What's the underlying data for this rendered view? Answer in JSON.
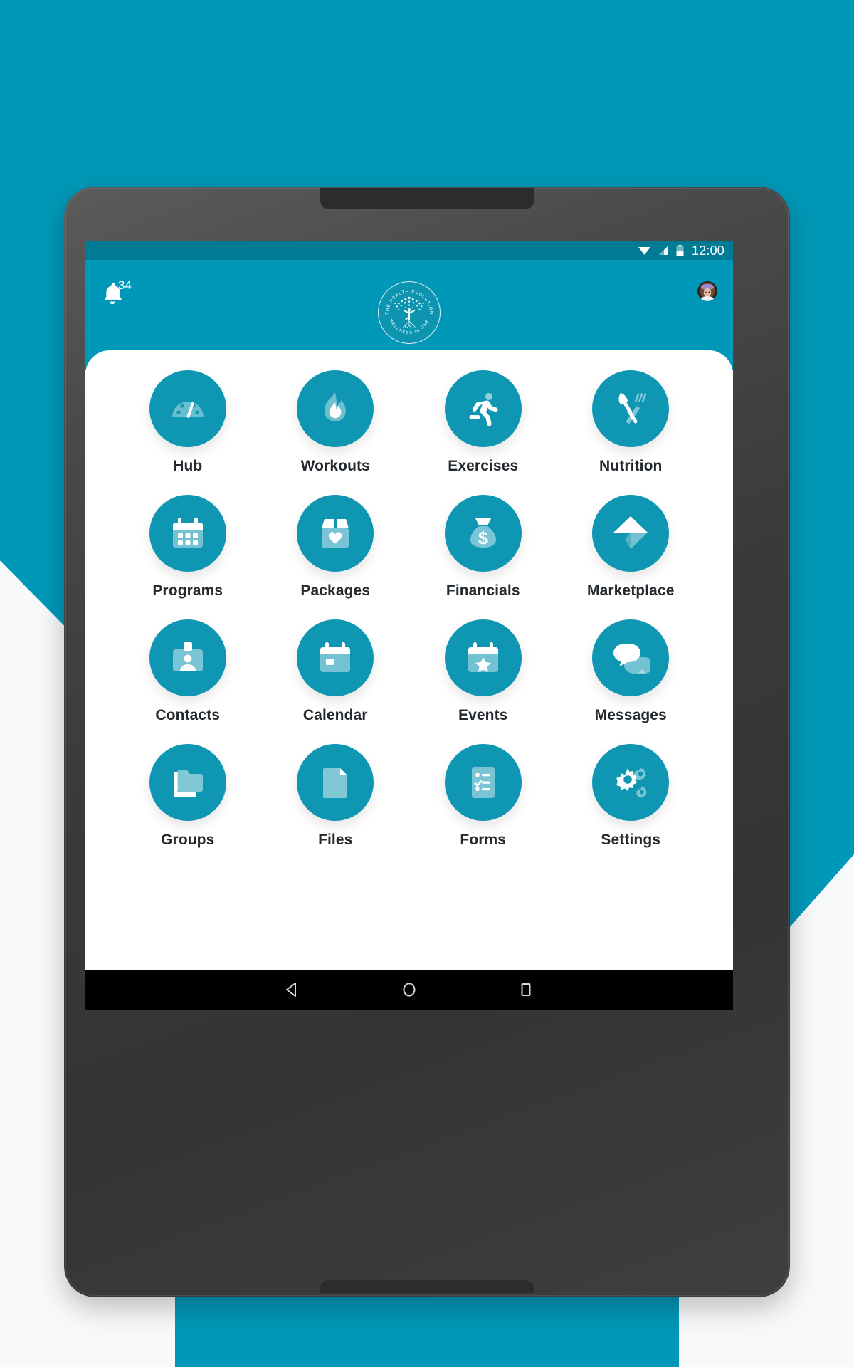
{
  "background": {
    "teal": "#0098b8",
    "offwhite": "#f7f9fb"
  },
  "device": {
    "type": "android-tablet",
    "bezel_color": "#3a3a3a"
  },
  "statusbar": {
    "time": "12:00",
    "icons": [
      "wifi-icon",
      "cellular-signal-icon",
      "battery-icon"
    ]
  },
  "appbar": {
    "background": "#0098b8",
    "notifications": {
      "icon": "bell-icon",
      "badge_count": "34"
    },
    "logo": {
      "icon": "tree-logo",
      "top_text": "THE HEALTH EVOLUTION",
      "bottom_text": "WELLNESS IN ONE"
    },
    "avatar": {
      "icon": "avatar",
      "label": "Profile"
    }
  },
  "grid": {
    "accent": "#0e96b3",
    "tiles": [
      {
        "label": "Hub",
        "icon": "gauge-icon"
      },
      {
        "label": "Workouts",
        "icon": "flame-icon"
      },
      {
        "label": "Exercises",
        "icon": "running-person-icon"
      },
      {
        "label": "Nutrition",
        "icon": "fork-knife-icon"
      },
      {
        "label": "Programs",
        "icon": "calendar-grid-icon"
      },
      {
        "label": "Packages",
        "icon": "box-heart-icon"
      },
      {
        "label": "Financials",
        "icon": "money-bag-icon"
      },
      {
        "label": "Marketplace",
        "icon": "paper-plane-icon"
      },
      {
        "label": "Contacts",
        "icon": "id-badge-icon"
      },
      {
        "label": "Calendar",
        "icon": "calendar-icon"
      },
      {
        "label": "Events",
        "icon": "calendar-star-icon"
      },
      {
        "label": "Messages",
        "icon": "speech-bubbles-icon"
      },
      {
        "label": "Groups",
        "icon": "folders-icon"
      },
      {
        "label": "Files",
        "icon": "document-icon"
      },
      {
        "label": "Forms",
        "icon": "checklist-icon"
      },
      {
        "label": "Settings",
        "icon": "gears-icon"
      }
    ]
  },
  "navbar": {
    "back": "back-triangle-icon",
    "home": "home-circle-icon",
    "recents": "recents-square-icon"
  }
}
